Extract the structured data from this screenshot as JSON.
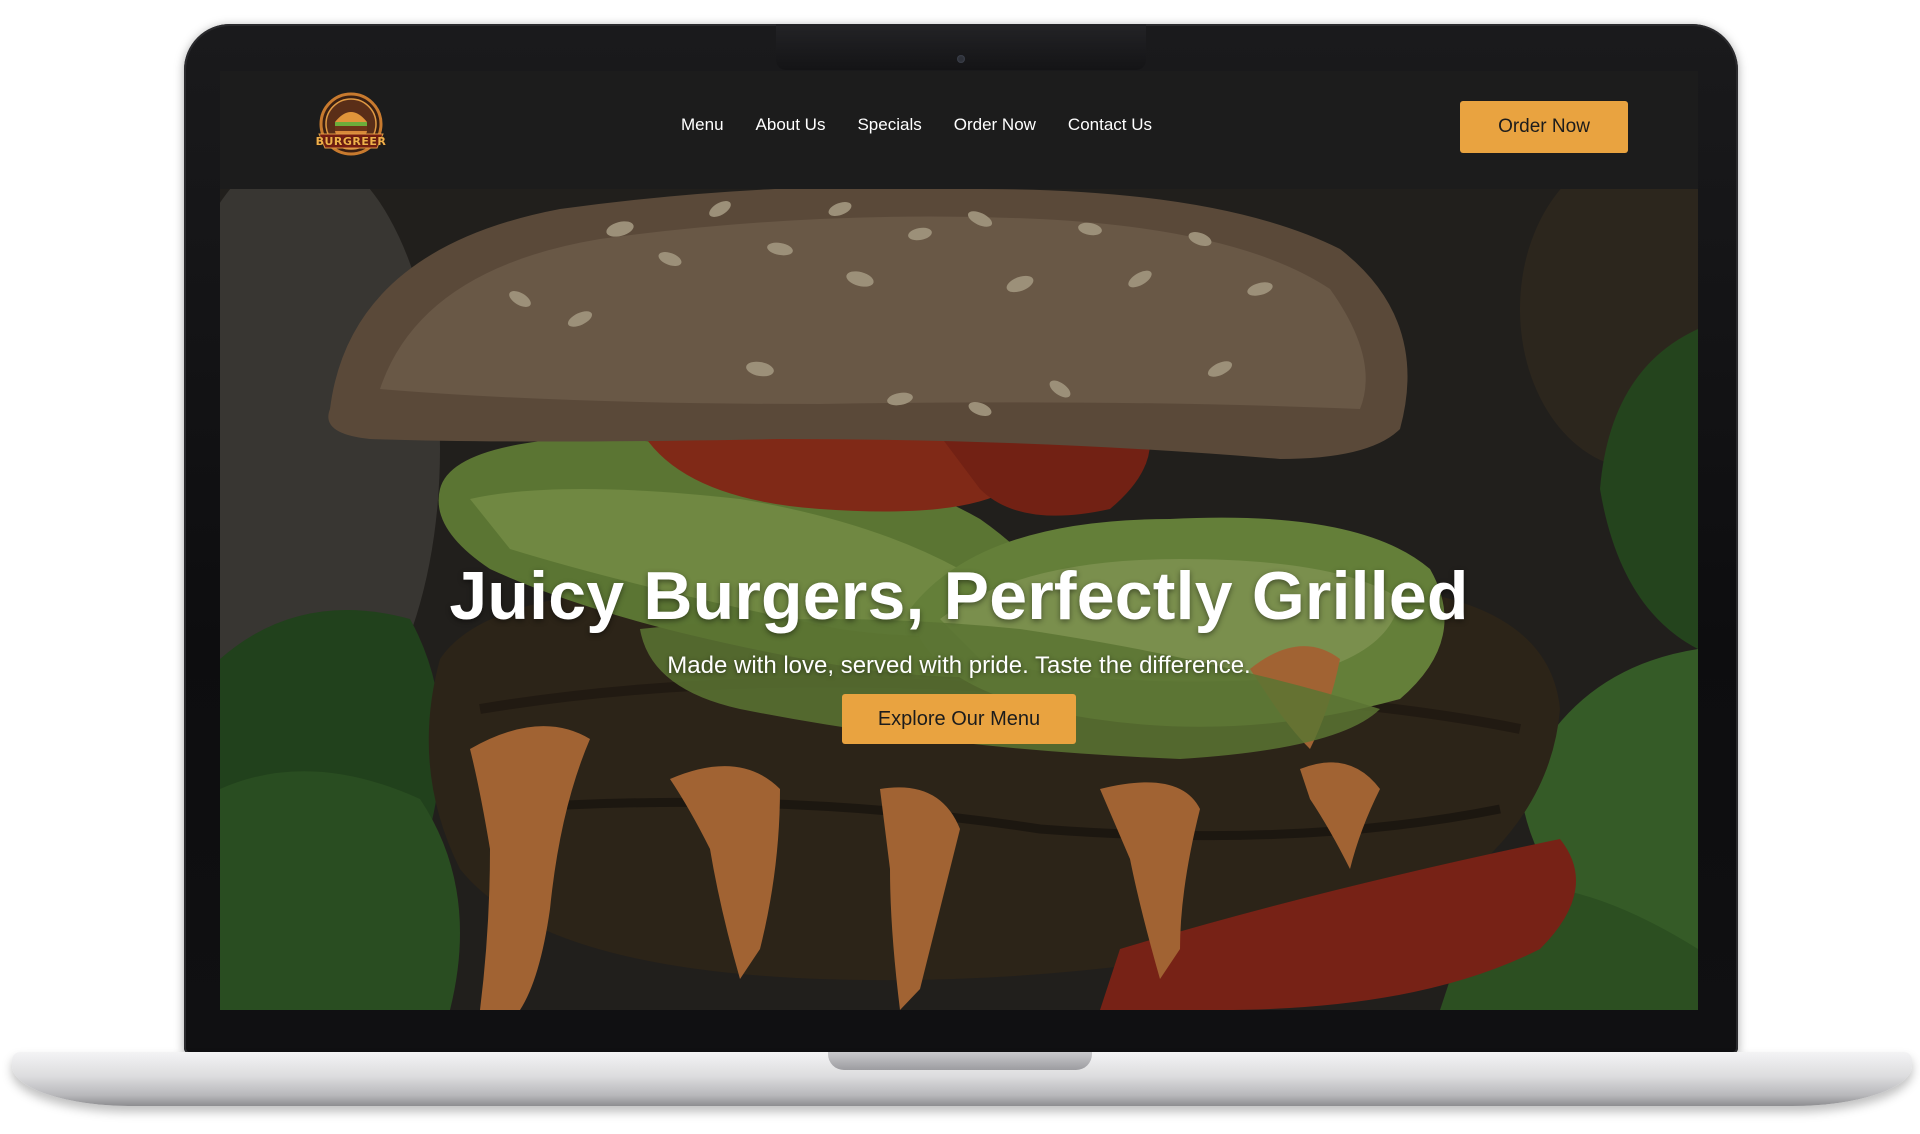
{
  "site": {
    "logo_text": "BURGREER",
    "nav_items": [
      {
        "label": "Menu"
      },
      {
        "label": "About Us"
      },
      {
        "label": "Specials"
      },
      {
        "label": "Order Now"
      },
      {
        "label": "Contact Us"
      }
    ],
    "order_button_label": "Order Now"
  },
  "hero": {
    "title": "Juicy Burgers, Perfectly Grilled",
    "subtitle": "Made with love, served with pride. Taste the difference.",
    "cta_label": "Explore Our Menu"
  },
  "colors": {
    "accent": "#e9a340",
    "navbar_bg": "#1c1c1c",
    "text_light": "#ffffff"
  }
}
